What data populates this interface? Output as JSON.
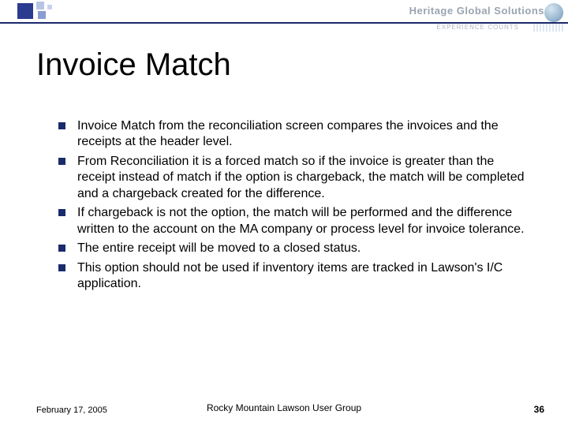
{
  "brand": {
    "name": "Heritage Global Solutions",
    "tagline": "EXPERIENCE COUNTS"
  },
  "title": "Invoice Match",
  "bullets": [
    "Invoice Match from the reconciliation screen compares the invoices and the receipts at the header level.",
    "From Reconciliation it is a forced match so if the invoice is greater than the receipt instead of match if the option is chargeback, the match will be completed and a chargeback created for the difference.",
    "If chargeback is not the option, the match will be performed and the difference written to the account on the MA company or process level for invoice tolerance.",
    "The entire receipt will be moved to a closed status.",
    "This option should not be used if inventory items are tracked in Lawson's I/C application."
  ],
  "footer": {
    "date": "February 17, 2005",
    "center": "Rocky Mountain Lawson User Group",
    "page": "36"
  }
}
